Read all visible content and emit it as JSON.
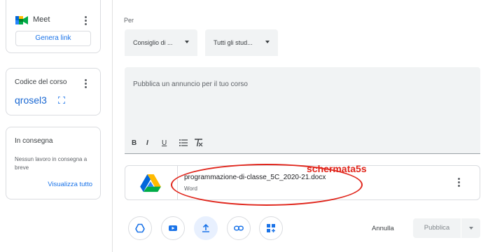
{
  "sidebar": {
    "meet": {
      "title": "Meet",
      "button": "Genera link"
    },
    "course_code": {
      "title": "Codice del corso",
      "value": "qrosel3"
    },
    "due": {
      "title": "In consegna",
      "text": "Nessun lavoro in consegna a breve",
      "link": "Visualizza tutto"
    }
  },
  "post": {
    "per_label": "Per",
    "class_select": "Consiglio di ...",
    "students_select": "Tutti gli stud...",
    "placeholder": "Pubblica un annuncio per il tuo corso",
    "format": {
      "bold": "B",
      "italic": "I",
      "underline": "U"
    }
  },
  "attachment": {
    "file_name": "programmazione-di-classe_5C_2020-21.docx",
    "file_type": "Word",
    "icon": "google-drive-icon"
  },
  "annotation": {
    "label": "schermata5s",
    "color": "#e0251b"
  },
  "toolbar_icons": [
    "google-drive-icon",
    "youtube-icon",
    "upload-icon",
    "link-icon",
    "create-icon"
  ],
  "actions": {
    "cancel": "Annulla",
    "publish": "Pubblica"
  },
  "colors": {
    "accent": "#1a73e8",
    "surface": "#f1f3f4",
    "annotation": "#e0251b"
  }
}
